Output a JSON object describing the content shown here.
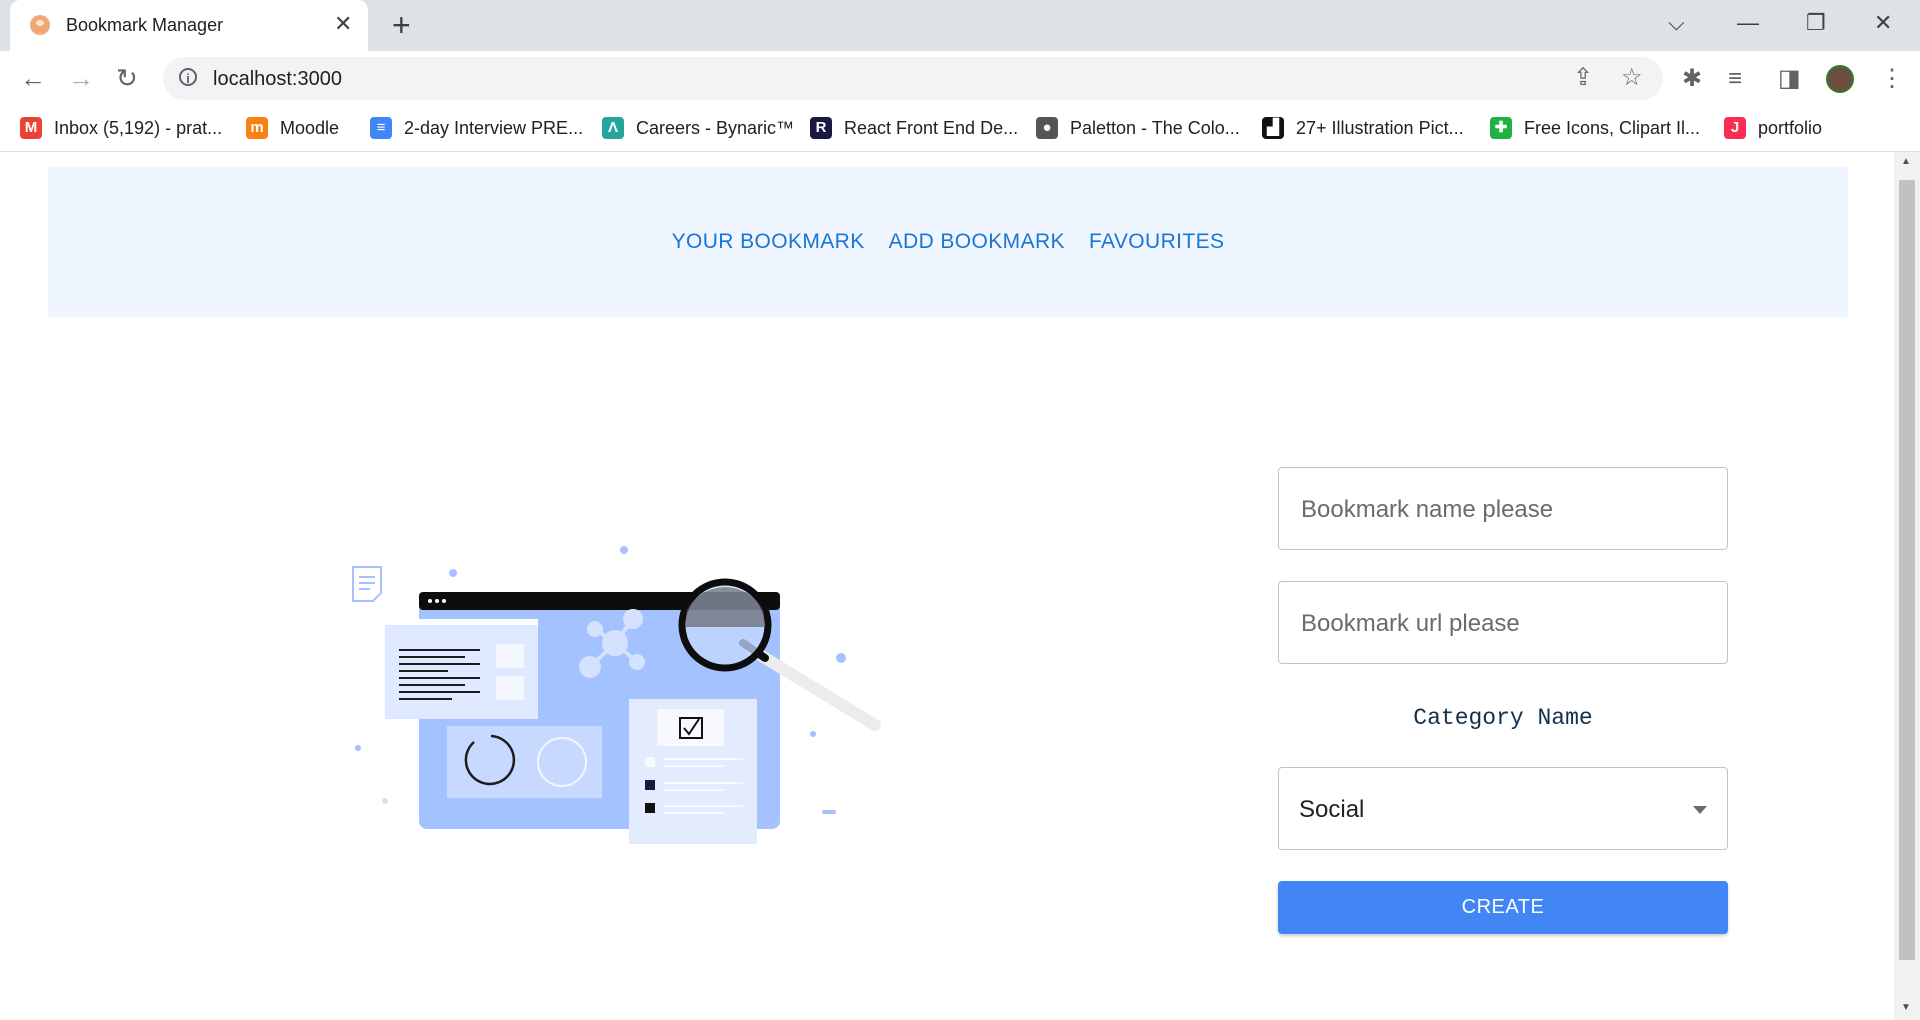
{
  "browser": {
    "tab_title": "Bookmark Manager",
    "url": "localhost:3000",
    "bookmarks": [
      {
        "label": "Inbox (5,192) - prat...",
        "icon": "gmail-icon",
        "color": "#ea4335"
      },
      {
        "label": "Moodle",
        "icon": "moodle-icon",
        "color": "#f98012"
      },
      {
        "label": "2-day Interview PRE...",
        "icon": "google-docs-icon",
        "color": "#4285f4"
      },
      {
        "label": "Careers - Bynaric™",
        "icon": "bynaric-icon",
        "color": "#26a69a"
      },
      {
        "label": "React Front End De...",
        "icon": "react-r-icon",
        "color": "#1a1a40"
      },
      {
        "label": "Paletton - The Colo...",
        "icon": "paletton-icon",
        "color": "#555555"
      },
      {
        "label": "27+ Illustration Pict...",
        "icon": "unsplash-icon",
        "color": "#111111"
      },
      {
        "label": "Free Icons, Clipart Il...",
        "icon": "icons8-icon",
        "color": "#1fb141"
      },
      {
        "label": "portfolio",
        "icon": "tiktok-icon",
        "color": "#fe2c55"
      }
    ]
  },
  "app": {
    "nav": [
      "YOUR BOOKMARK",
      "ADD BOOKMARK",
      "FAVOURITES"
    ],
    "form": {
      "name_placeholder": "Bookmark name please",
      "url_placeholder": "Bookmark url please",
      "category_label": "Category Name",
      "category_value": "Social",
      "create_label": "CREATE"
    },
    "colors": {
      "nav_link": "#1976d2",
      "header_bg": "#f0f6ff",
      "button": "#4285f4"
    }
  }
}
